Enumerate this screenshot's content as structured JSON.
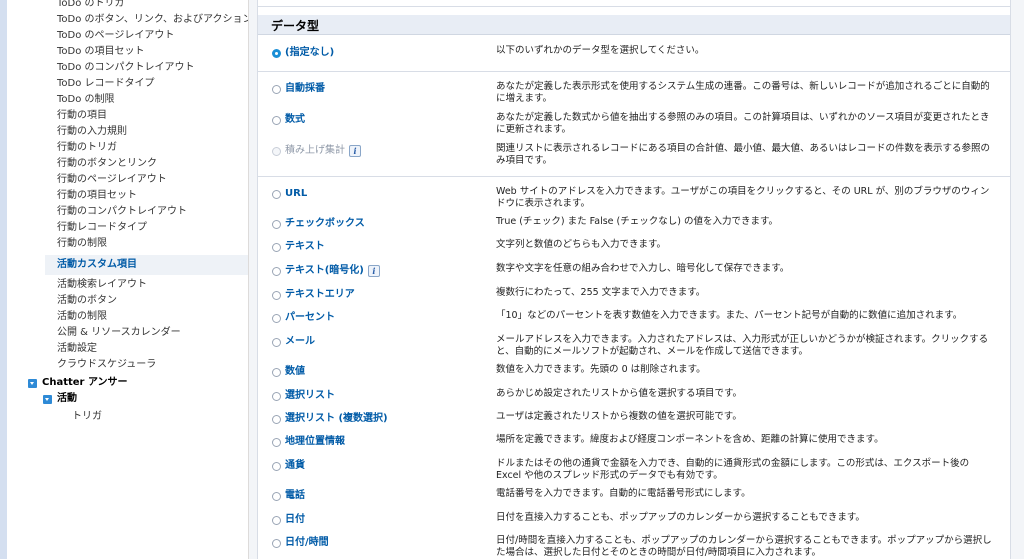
{
  "sidebar": {
    "items": [
      {
        "label": "ToDo のトリガ"
      },
      {
        "label": "ToDo のボタン、リンク、およびアクション"
      },
      {
        "label": "ToDo のページレイアウト"
      },
      {
        "label": "ToDo の項目セット"
      },
      {
        "label": "ToDo のコンパクトレイアウト"
      },
      {
        "label": "ToDo レコードタイプ"
      },
      {
        "label": "ToDo の制限"
      },
      {
        "label": "行動の項目"
      },
      {
        "label": "行動の入力規則"
      },
      {
        "label": "行動のトリガ"
      },
      {
        "label": "行動のボタンとリンク"
      },
      {
        "label": "行動のページレイアウト"
      },
      {
        "label": "行動の項目セット"
      },
      {
        "label": "行動のコンパクトレイアウト"
      },
      {
        "label": "行動レコードタイプ"
      },
      {
        "label": "行動の制限"
      },
      {
        "label": "活動カスタム項目"
      },
      {
        "label": "活動検索レイアウト"
      },
      {
        "label": "活動のボタン"
      },
      {
        "label": "活動の制限"
      },
      {
        "label": "公開 & リソースカレンダー"
      },
      {
        "label": "活動設定"
      },
      {
        "label": "クラウドスケジューラ"
      }
    ],
    "groups": {
      "chatter": "Chatter アンサー",
      "activity": "活動",
      "trigger": "トリガ"
    }
  },
  "section_title": "データ型",
  "types": [
    {
      "label": "(指定なし)",
      "desc": "以下のいずれかのデータ型を選択してください。"
    },
    {
      "label": "自動採番",
      "desc": "あなたが定義した表示形式を使用するシステム生成の連番。この番号は、新しいレコードが追加されるごとに自動的に増えます。"
    },
    {
      "label": "数式",
      "desc": "あなたが定義した数式から値を抽出する参照のみの項目。この計算項目は、いずれかのソース項目が変更されたときに更新されます。"
    },
    {
      "label": "積み上げ集計",
      "desc": "関連リストに表示されるレコードにある項目の合計値、最小値、最大値、あるいはレコードの件数を表示する参照のみ項目です。"
    },
    {
      "label": "URL",
      "desc": "Web サイトのアドレスを入力できます。ユーザがこの項目をクリックすると、その URL が、別のブラウザのウィンドウに表示されます。"
    },
    {
      "label": "チェックボックス",
      "desc": "True (チェック) また False (チェックなし) の値を入力できます。"
    },
    {
      "label": "テキスト",
      "desc": "文字列と数値のどちらも入力できます。"
    },
    {
      "label": "テキスト(暗号化)",
      "desc": "数字や文字を任意の組み合わせで入力し、暗号化して保存できます。"
    },
    {
      "label": "テキストエリア",
      "desc": "複数行にわたって、255 文字まで入力できます。"
    },
    {
      "label": "パーセント",
      "desc": "「10」などのパーセントを表す数値を入力できます。また、パーセント記号が自動的に数値に追加されます。"
    },
    {
      "label": "メール",
      "desc": "メールアドレスを入力できます。入力されたアドレスは、入力形式が正しいかどうかが検証されます。クリックすると、自動的にメールソフトが起動され、メールを作成して送信できます。"
    },
    {
      "label": "数値",
      "desc": "数値を入力できます。先頭の 0 は削除されます。"
    },
    {
      "label": "選択リスト",
      "desc": "あらかじめ設定されたリストから値を選択する項目です。"
    },
    {
      "label": "選択リスト (複数選択)",
      "desc": "ユーザは定義されたリストから複数の値を選択可能です。"
    },
    {
      "label": "地理位置情報",
      "desc": "場所を定義できます。緯度および経度コンポーネントを含め、距離の計算に使用できます。"
    },
    {
      "label": "通貨",
      "desc": "ドルまたはその他の通貨で金額を入力でき、自動的に通貨形式の金額にします。この形式は、エクスポート後の Excel や他のスプレッド形式のデータでも有効です。"
    },
    {
      "label": "電話",
      "desc": "電話番号を入力できます。自動的に電話番号形式にします。"
    },
    {
      "label": "日付",
      "desc": "日付を直接入力することも、ポップアップのカレンダーから選択することもできます。"
    },
    {
      "label": "日付/時間",
      "desc": "日付/時間を直接入力することも、ポップアップのカレンダーから選択することもできます。ポップアップから選択した場合は、選択した日付とそのときの時間が日付/時間項目に入力されます。"
    }
  ],
  "info_icon_glyph": "i"
}
